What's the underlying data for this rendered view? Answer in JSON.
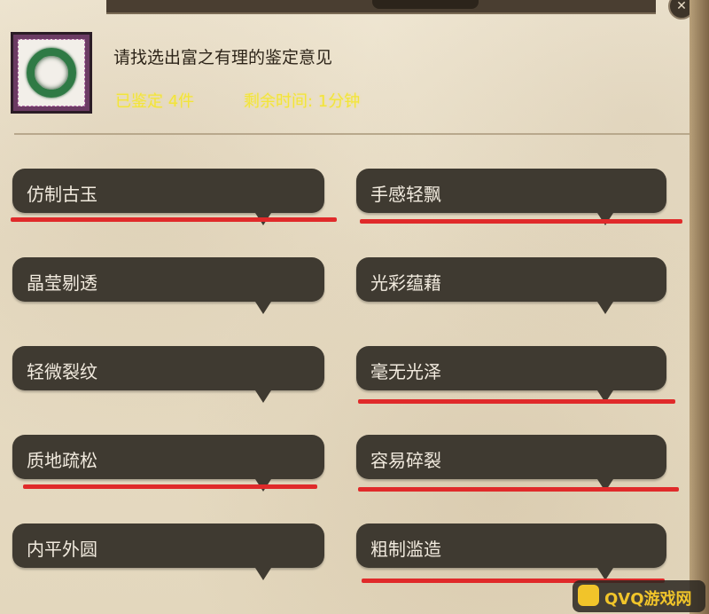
{
  "header": {
    "close_symbol": "✕"
  },
  "item": {
    "icon": "jade-bracelet-icon",
    "prompt": "请找选出富之有理的鉴定意见"
  },
  "stats": [
    {
      "text": "已鉴定 4件"
    },
    {
      "text": "剩余时间: 1分钟"
    }
  ],
  "options": [
    {
      "label": "仿制古玉",
      "underlined": true
    },
    {
      "label": "手感轻飘",
      "underlined": true
    },
    {
      "label": "晶莹剔透",
      "underlined": false
    },
    {
      "label": "光彩蕴藉",
      "underlined": false
    },
    {
      "label": "轻微裂纹",
      "underlined": false
    },
    {
      "label": "毫无光泽",
      "underlined": true
    },
    {
      "label": "质地疏松",
      "underlined": true
    },
    {
      "label": "容易碎裂",
      "underlined": true
    },
    {
      "label": "内平外圆",
      "underlined": false
    },
    {
      "label": "粗制滥造",
      "underlined": true
    }
  ],
  "colors": {
    "bubble": "#3f3a31",
    "underline": "#e02a2a",
    "stat_text": "#f2e43a"
  },
  "watermark": {
    "text": "QVQ游戏网"
  }
}
